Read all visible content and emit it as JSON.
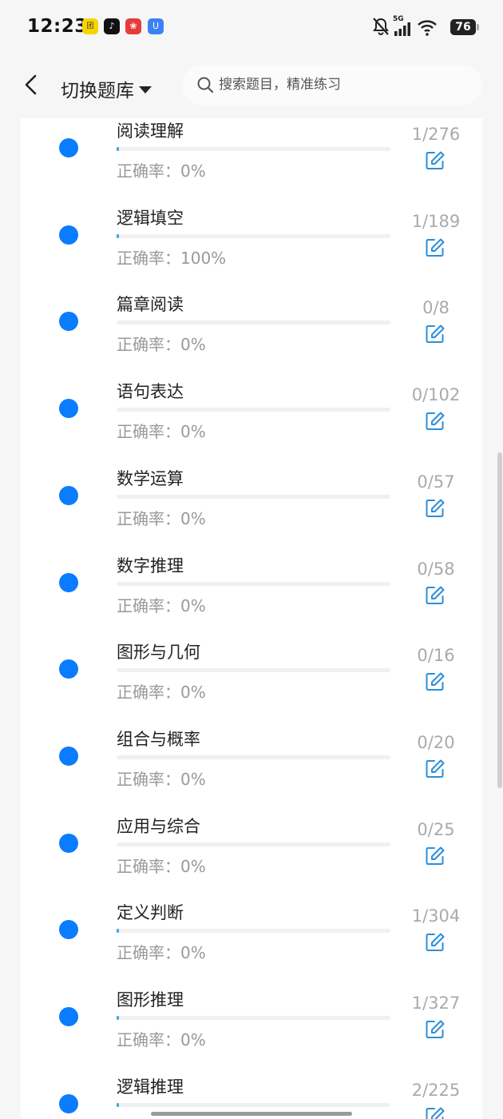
{
  "status_bar": {
    "time": "12:23",
    "app_icons": [
      "meituan-icon",
      "tiktok-icon",
      "pinduoduo-icon",
      "u-app-icon"
    ],
    "network": "5G",
    "battery": "76"
  },
  "header": {
    "bank_switch_label": "切换题库",
    "search_placeholder": "搜索题目，精准练习"
  },
  "accuracy_prefix": "正确率：",
  "accent_color": "#0a7cff",
  "topics": [
    {
      "name": "阅读理解",
      "count": "1/276",
      "accuracy": "正确率：0%",
      "progress": 0.0036
    },
    {
      "name": "逻辑填空",
      "count": "1/189",
      "accuracy": "正确率：100%",
      "progress": 0.0053
    },
    {
      "name": "篇章阅读",
      "count": "0/8",
      "accuracy": "正确率：0%",
      "progress": 0
    },
    {
      "name": "语句表达",
      "count": "0/102",
      "accuracy": "正确率：0%",
      "progress": 0
    },
    {
      "name": "数学运算",
      "count": "0/57",
      "accuracy": "正确率：0%",
      "progress": 0
    },
    {
      "name": "数字推理",
      "count": "0/58",
      "accuracy": "正确率：0%",
      "progress": 0
    },
    {
      "name": "图形与几何",
      "count": "0/16",
      "accuracy": "正确率：0%",
      "progress": 0
    },
    {
      "name": "组合与概率",
      "count": "0/20",
      "accuracy": "正确率：0%",
      "progress": 0
    },
    {
      "name": "应用与综合",
      "count": "0/25",
      "accuracy": "正确率：0%",
      "progress": 0
    },
    {
      "name": "定义判断",
      "count": "1/304",
      "accuracy": "正确率：0%",
      "progress": 0.0033
    },
    {
      "name": "图形推理",
      "count": "1/327",
      "accuracy": "正确率：0%",
      "progress": 0.0031
    },
    {
      "name": "逻辑推理",
      "count": "2/225",
      "accuracy": "",
      "progress": 0.0089
    }
  ]
}
